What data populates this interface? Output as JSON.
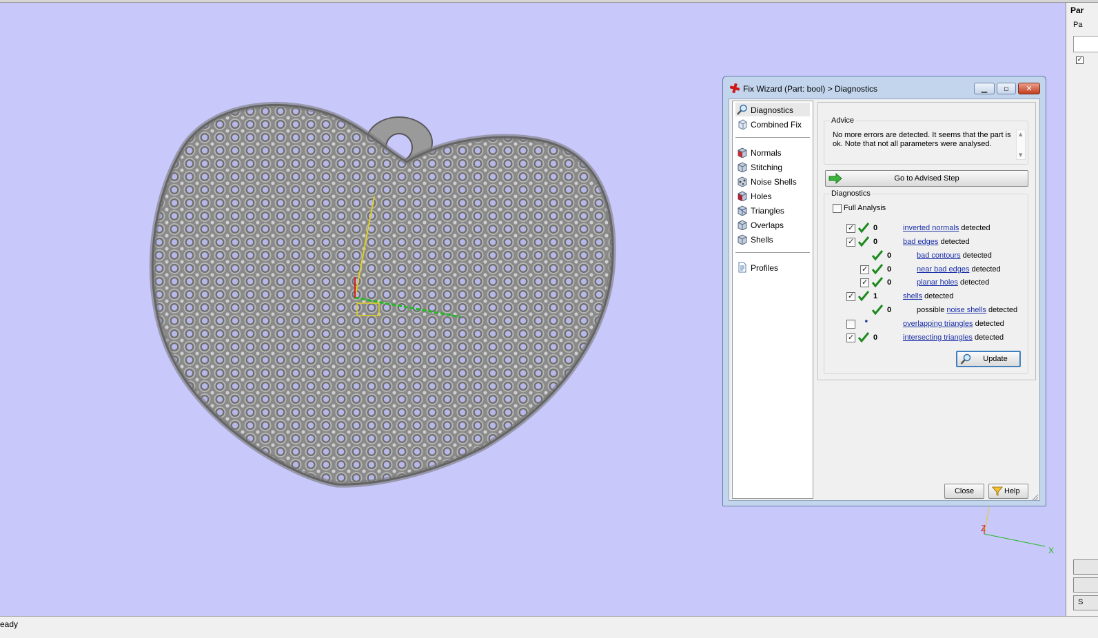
{
  "colors": {
    "viewport_bg": "#c8c8fb",
    "link": "#1a2fa8",
    "check_ok": "#1c8a1c",
    "dialog_frame": "#c3d5ec"
  },
  "dialog": {
    "title": "Fix Wizard (Part: bool) > Diagnostics",
    "title_icon": "fix-wizard-red-cross-icon",
    "nav_top": [
      {
        "label": "Diagnostics",
        "icon": "magnifier-icon"
      },
      {
        "label": "Combined Fix",
        "icon": "cube-icon"
      }
    ],
    "nav_steps": [
      {
        "label": "Normals",
        "icon": "normals-cube-icon"
      },
      {
        "label": "Stitching",
        "icon": "stitching-cube-icon"
      },
      {
        "label": "Noise Shells",
        "icon": "noise-shells-icon"
      },
      {
        "label": "Holes",
        "icon": "holes-cube-icon"
      },
      {
        "label": "Triangles",
        "icon": "triangles-cube-icon"
      },
      {
        "label": "Overlaps",
        "icon": "overlaps-cube-icon"
      },
      {
        "label": "Shells",
        "icon": "shells-cube-icon"
      }
    ],
    "nav_bottom": [
      {
        "label": "Profiles",
        "icon": "document-icon"
      }
    ],
    "advice": {
      "label": "Advice",
      "text": "No more errors are detected. It seems that the part is ok. Note that not all parameters were analysed."
    },
    "advised_button": "Go to Advised Step",
    "diagnostics": {
      "label": "Diagnostics",
      "full_analysis": "Full Analysis",
      "rows": [
        {
          "value": "0",
          "link": "inverted normals",
          "suffix": " detected",
          "prefix": ""
        },
        {
          "value": "0",
          "link": "bad edges",
          "suffix": " detected",
          "prefix": ""
        },
        {
          "value": "0",
          "link": "bad contours",
          "suffix": " detected",
          "prefix": ""
        },
        {
          "value": "0",
          "link": "near bad edges",
          "suffix": " detected",
          "prefix": ""
        },
        {
          "value": "0",
          "link": "planar holes",
          "suffix": " detected",
          "prefix": ""
        },
        {
          "value": "1",
          "link": "shells",
          "suffix": " detected",
          "prefix": ""
        },
        {
          "value": "0",
          "link": "noise shells",
          "suffix": " detected",
          "prefix": "possible "
        },
        {
          "value": "",
          "link": "overlapping triangles",
          "suffix": " detected",
          "prefix": ""
        },
        {
          "value": "0",
          "link": "intersecting triangles",
          "suffix": " detected",
          "prefix": ""
        }
      ]
    },
    "update_button": "Update",
    "close_button": "Close",
    "help_button": "Help"
  },
  "axis_labels": {
    "z": "Z",
    "x": "X"
  },
  "side_panel": {
    "header": "Par",
    "sub": "Pa",
    "bottom_button": "S"
  },
  "status": {
    "text": "eady"
  }
}
